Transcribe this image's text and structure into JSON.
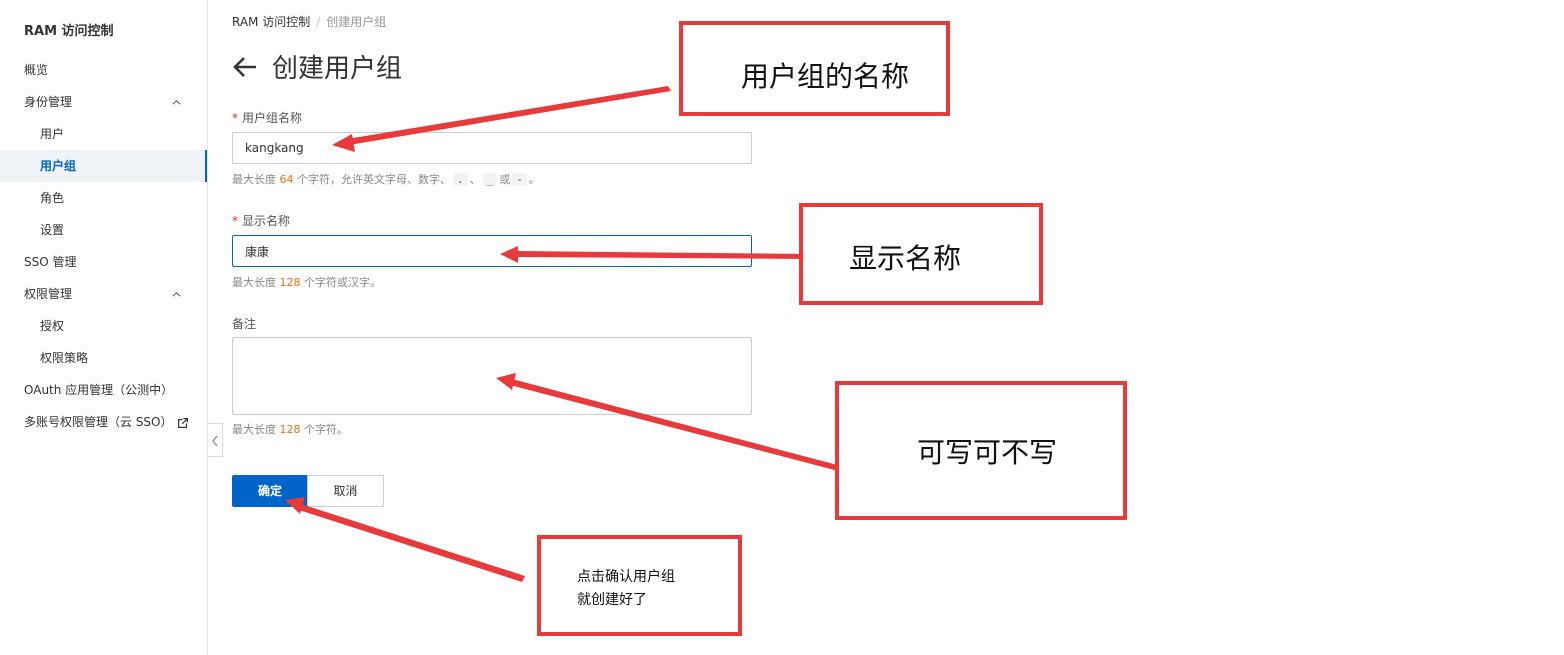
{
  "sidebar": {
    "title": "RAM 访问控制",
    "items": [
      {
        "label": "概览"
      },
      {
        "label": "身份管理"
      },
      {
        "label": "用户"
      },
      {
        "label": "用户组"
      },
      {
        "label": "角色"
      },
      {
        "label": "设置"
      },
      {
        "label": "SSO 管理"
      },
      {
        "label": "权限管理"
      },
      {
        "label": "授权"
      },
      {
        "label": "权限策略"
      },
      {
        "label": "OAuth 应用管理（公测中）"
      },
      {
        "label": "多账号权限管理（云 SSO）"
      }
    ],
    "active_item": "用户组",
    "icons": [
      "chevron-up-icon",
      "external-link-icon",
      "chevron-left-icon"
    ]
  },
  "breadcrumb": {
    "root": "RAM 访问控制",
    "separator": "/",
    "current": "创建用户组"
  },
  "page": {
    "title": "创建用户组"
  },
  "form": {
    "group_name": {
      "required_mark": "*",
      "label": "用户组名称",
      "value": "kangkang",
      "hint_prefix": "最大长度 ",
      "hint_num": "64",
      "hint_mid": " 个字符，允许英文字母、数字、",
      "chip_dot": ".",
      "sep": "、",
      "chip_underscore": "_",
      "or": "或",
      "chip_dash": "-",
      "end": "。"
    },
    "display_name": {
      "required_mark": "*",
      "label": "显示名称",
      "value": "康康",
      "hint_prefix": "最大长度 ",
      "hint_num": "128",
      "hint_suffix": " 个字符或汉字。"
    },
    "remark": {
      "label": "备注",
      "value": "",
      "hint_prefix": "最大长度 ",
      "hint_num": "128",
      "hint_suffix": " 个字符。"
    },
    "confirm_label": "确定",
    "cancel_label": "取消"
  },
  "annotations": {
    "group_name_note": "用户组的名称",
    "display_name_note": "显示名称",
    "remark_note": "可写可不写",
    "confirm_note_line1": "点击确认用户组",
    "confirm_note_line2": "就创建好了"
  },
  "colors": {
    "primary": "#0064c8",
    "annotation_red": "#e83a3a",
    "hint_number": "#e8730c"
  }
}
